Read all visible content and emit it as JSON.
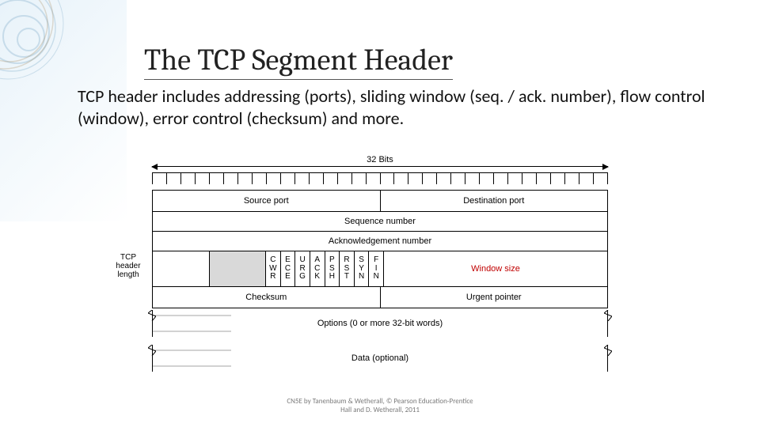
{
  "slide": {
    "title": "The TCP Segment Header",
    "body": "TCP header includes addressing (ports), sliding window (seq. / ack. number), flow control (window), error control (checksum) and more.",
    "footer_line1": "CN5E by Tanenbaum & Wetherall, © Pearson Education-Prentice",
    "footer_line2": "Hall and D. Wetherall, 2011"
  },
  "diagram": {
    "ruler_label": "32 Bits",
    "row1": {
      "source_port": "Source port",
      "dest_port": "Destination port"
    },
    "row2": {
      "sequence": "Sequence number"
    },
    "row3": {
      "ack": "Acknowledgement number"
    },
    "row4": {
      "tcp_header_length": "TCP\nheader\nlength",
      "flags": [
        "C\nW\nR",
        "E\nC\nE",
        "U\nR\nG",
        "A\nC\nK",
        "P\nS\nH",
        "R\nS\nT",
        "S\nY\nN",
        "F\nI\nN"
      ],
      "window_size": "Window size"
    },
    "row5": {
      "checksum": "Checksum",
      "urgent": "Urgent pointer"
    },
    "options": "Options (0 or more 32-bit words)",
    "data": "Data (optional)"
  }
}
